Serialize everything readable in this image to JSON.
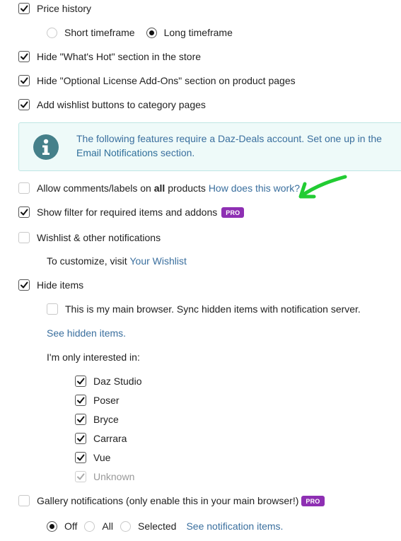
{
  "settings": {
    "price_history": {
      "label": "Price history",
      "checked": true
    },
    "timeframe": {
      "short": "Short timeframe",
      "long": "Long timeframe",
      "selected": "long"
    },
    "hide_whats_hot": {
      "label": "Hide \"What's Hot\" section in the store",
      "checked": true
    },
    "hide_optional_addons": {
      "label": "Hide \"Optional License Add-Ons\" section on product pages",
      "checked": true
    },
    "wishlist_buttons": {
      "label": "Add wishlist buttons to category pages",
      "checked": true
    }
  },
  "info": {
    "text_before": "The following features require a Daz-Deals account. Set one up in the",
    "link": "Email Notifications",
    "text_after": "section.",
    "icon": "info-icon"
  },
  "comments": {
    "label_prefix": "Allow comments/labels on",
    "label_bold": "all",
    "label_suffix": "products",
    "link": "How does this work?",
    "checked": false
  },
  "filter": {
    "label": "Show filter for required items and addons",
    "badge": "PRO",
    "checked": true
  },
  "wishlist_notifications": {
    "label": "Wishlist & other notifications",
    "checked": false,
    "customize_prefix": "To customize, visit",
    "customize_link": "Your Wishlist"
  },
  "hide_items": {
    "label": "Hide items",
    "checked": true,
    "sync": {
      "label": "This is my main browser. Sync hidden items with notification server.",
      "checked": false
    },
    "see_hidden": "See hidden items.",
    "interested_label": "I'm only interested in:",
    "options": [
      {
        "label": "Daz Studio",
        "checked": true,
        "disabled": false
      },
      {
        "label": "Poser",
        "checked": true,
        "disabled": false
      },
      {
        "label": "Bryce",
        "checked": true,
        "disabled": false
      },
      {
        "label": "Carrara",
        "checked": true,
        "disabled": false
      },
      {
        "label": "Vue",
        "checked": true,
        "disabled": false
      },
      {
        "label": "Unknown",
        "checked": true,
        "disabled": true
      }
    ]
  },
  "gallery": {
    "label": "Gallery notifications (only enable this in your main browser!)",
    "badge": "PRO",
    "checked": false,
    "options": [
      "Off",
      "All",
      "Selected"
    ],
    "selected": "Off",
    "link": "See notification items."
  },
  "colors": {
    "link": "#3a6f9e",
    "pro_badge": "#8e2fb3",
    "info_bg": "#eefaf9",
    "info_icon": "#45808a",
    "arrow": "#22cc33"
  }
}
